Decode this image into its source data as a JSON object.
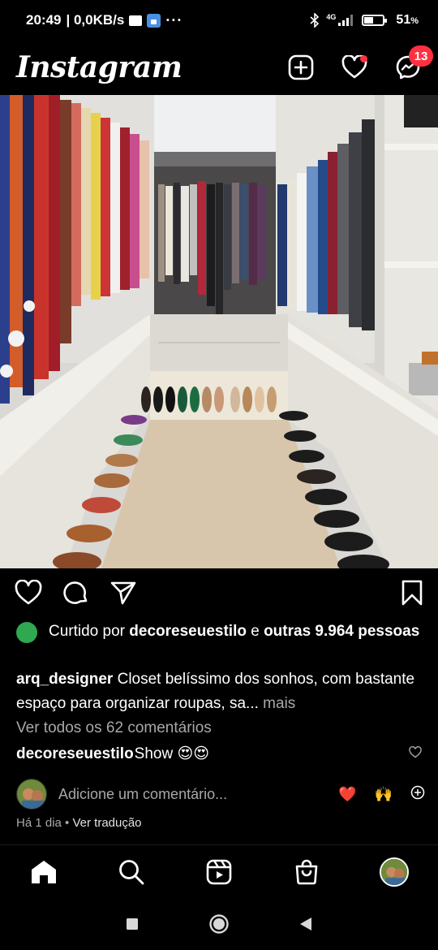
{
  "status": {
    "time": "20:49",
    "speed": "| 0,0KB/s",
    "more": "···",
    "network": "4G",
    "battery": "51",
    "battery_unit": "%"
  },
  "header": {
    "logo": "Instagram",
    "messenger_badge": "13"
  },
  "post": {
    "liked_prefix": "Curtido por ",
    "liked_user": "decoreseuestilo",
    "liked_mid": " e ",
    "liked_others": "outras 9.964 pessoas",
    "author": "arq_designer",
    "caption": " Closet belíssimo dos sonhos, com bastante espaço para organizar roupas, sa...",
    "more_label": " mais",
    "view_comments": "Ver todos os 62 comentários",
    "comment_user": "decoreseuestilo",
    "comment_text": " Show 😍😍",
    "add_comment_placeholder": "Adicione um comentário...",
    "quick_emoji_1": "❤️",
    "quick_emoji_2": "🙌",
    "time_ago": "Há 1 dia",
    "separator": " • ",
    "translate": "Ver tradução"
  },
  "colors": {
    "accent_red": "#ff3040",
    "muted_text": "#a8a8a8",
    "liked_avatar": "#2fa84f"
  }
}
